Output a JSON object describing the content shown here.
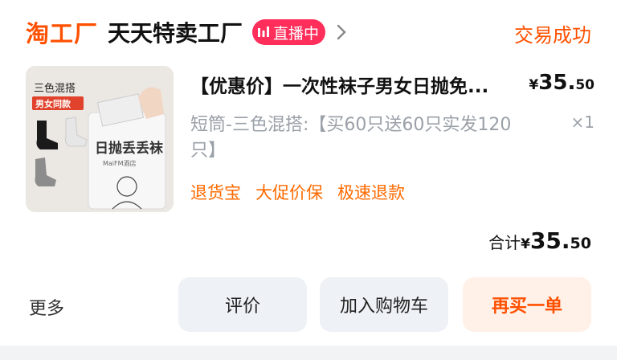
{
  "header": {
    "store_brand": "淘工厂",
    "store_name": "天天特卖工厂",
    "live_badge": "直播中",
    "status": "交易成功"
  },
  "product": {
    "title": "【优惠价】一次性袜子男女日抛免...",
    "price_symbol": "¥",
    "price_int": "35.",
    "price_dec": "50",
    "sku": "短筒-三色混搭:【买60只送60只实发120只】",
    "quantity": "×1",
    "services": [
      "退货宝",
      "大促价保",
      "极速退款"
    ],
    "image": {
      "banner": "三色混搭",
      "tag": "男女同款",
      "pack_text": "日抛丢丢袜",
      "pack_small": "MaiFM酒店"
    }
  },
  "total": {
    "label": "合计",
    "symbol": "¥",
    "int": "35.",
    "dec": "50"
  },
  "actions": {
    "more": "更多",
    "review": "评价",
    "add_cart": "加入购物车",
    "rebuy": "再买一单"
  },
  "colors": {
    "brand_orange": "#ff5000",
    "live_pink": "#ff2e5b",
    "muted_gray": "#9aa0a8",
    "button_gray": "#eef1f5",
    "rebuy_bg": "#fff1e8"
  }
}
